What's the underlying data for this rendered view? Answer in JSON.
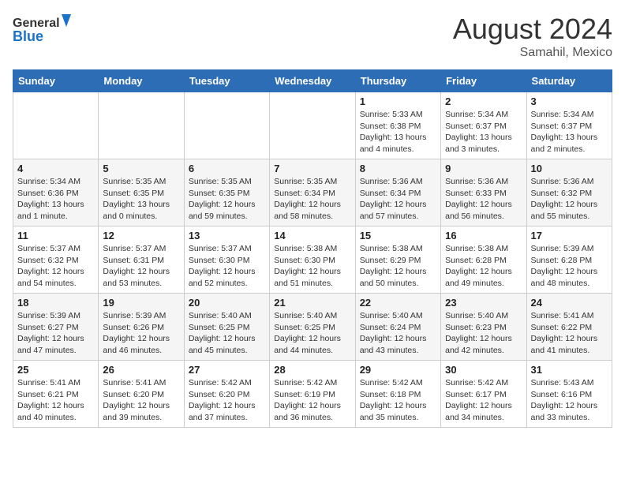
{
  "header": {
    "logo_general": "General",
    "logo_blue": "Blue",
    "month_year": "August 2024",
    "location": "Samahil, Mexico"
  },
  "days_of_week": [
    "Sunday",
    "Monday",
    "Tuesday",
    "Wednesday",
    "Thursday",
    "Friday",
    "Saturday"
  ],
  "weeks": [
    [
      {
        "day": "",
        "info": ""
      },
      {
        "day": "",
        "info": ""
      },
      {
        "day": "",
        "info": ""
      },
      {
        "day": "",
        "info": ""
      },
      {
        "day": "1",
        "info": "Sunrise: 5:33 AM\nSunset: 6:38 PM\nDaylight: 13 hours\nand 4 minutes."
      },
      {
        "day": "2",
        "info": "Sunrise: 5:34 AM\nSunset: 6:37 PM\nDaylight: 13 hours\nand 3 minutes."
      },
      {
        "day": "3",
        "info": "Sunrise: 5:34 AM\nSunset: 6:37 PM\nDaylight: 13 hours\nand 2 minutes."
      }
    ],
    [
      {
        "day": "4",
        "info": "Sunrise: 5:34 AM\nSunset: 6:36 PM\nDaylight: 13 hours\nand 1 minute."
      },
      {
        "day": "5",
        "info": "Sunrise: 5:35 AM\nSunset: 6:35 PM\nDaylight: 13 hours\nand 0 minutes."
      },
      {
        "day": "6",
        "info": "Sunrise: 5:35 AM\nSunset: 6:35 PM\nDaylight: 12 hours\nand 59 minutes."
      },
      {
        "day": "7",
        "info": "Sunrise: 5:35 AM\nSunset: 6:34 PM\nDaylight: 12 hours\nand 58 minutes."
      },
      {
        "day": "8",
        "info": "Sunrise: 5:36 AM\nSunset: 6:34 PM\nDaylight: 12 hours\nand 57 minutes."
      },
      {
        "day": "9",
        "info": "Sunrise: 5:36 AM\nSunset: 6:33 PM\nDaylight: 12 hours\nand 56 minutes."
      },
      {
        "day": "10",
        "info": "Sunrise: 5:36 AM\nSunset: 6:32 PM\nDaylight: 12 hours\nand 55 minutes."
      }
    ],
    [
      {
        "day": "11",
        "info": "Sunrise: 5:37 AM\nSunset: 6:32 PM\nDaylight: 12 hours\nand 54 minutes."
      },
      {
        "day": "12",
        "info": "Sunrise: 5:37 AM\nSunset: 6:31 PM\nDaylight: 12 hours\nand 53 minutes."
      },
      {
        "day": "13",
        "info": "Sunrise: 5:37 AM\nSunset: 6:30 PM\nDaylight: 12 hours\nand 52 minutes."
      },
      {
        "day": "14",
        "info": "Sunrise: 5:38 AM\nSunset: 6:30 PM\nDaylight: 12 hours\nand 51 minutes."
      },
      {
        "day": "15",
        "info": "Sunrise: 5:38 AM\nSunset: 6:29 PM\nDaylight: 12 hours\nand 50 minutes."
      },
      {
        "day": "16",
        "info": "Sunrise: 5:38 AM\nSunset: 6:28 PM\nDaylight: 12 hours\nand 49 minutes."
      },
      {
        "day": "17",
        "info": "Sunrise: 5:39 AM\nSunset: 6:28 PM\nDaylight: 12 hours\nand 48 minutes."
      }
    ],
    [
      {
        "day": "18",
        "info": "Sunrise: 5:39 AM\nSunset: 6:27 PM\nDaylight: 12 hours\nand 47 minutes."
      },
      {
        "day": "19",
        "info": "Sunrise: 5:39 AM\nSunset: 6:26 PM\nDaylight: 12 hours\nand 46 minutes."
      },
      {
        "day": "20",
        "info": "Sunrise: 5:40 AM\nSunset: 6:25 PM\nDaylight: 12 hours\nand 45 minutes."
      },
      {
        "day": "21",
        "info": "Sunrise: 5:40 AM\nSunset: 6:25 PM\nDaylight: 12 hours\nand 44 minutes."
      },
      {
        "day": "22",
        "info": "Sunrise: 5:40 AM\nSunset: 6:24 PM\nDaylight: 12 hours\nand 43 minutes."
      },
      {
        "day": "23",
        "info": "Sunrise: 5:40 AM\nSunset: 6:23 PM\nDaylight: 12 hours\nand 42 minutes."
      },
      {
        "day": "24",
        "info": "Sunrise: 5:41 AM\nSunset: 6:22 PM\nDaylight: 12 hours\nand 41 minutes."
      }
    ],
    [
      {
        "day": "25",
        "info": "Sunrise: 5:41 AM\nSunset: 6:21 PM\nDaylight: 12 hours\nand 40 minutes."
      },
      {
        "day": "26",
        "info": "Sunrise: 5:41 AM\nSunset: 6:20 PM\nDaylight: 12 hours\nand 39 minutes."
      },
      {
        "day": "27",
        "info": "Sunrise: 5:42 AM\nSunset: 6:20 PM\nDaylight: 12 hours\nand 37 minutes."
      },
      {
        "day": "28",
        "info": "Sunrise: 5:42 AM\nSunset: 6:19 PM\nDaylight: 12 hours\nand 36 minutes."
      },
      {
        "day": "29",
        "info": "Sunrise: 5:42 AM\nSunset: 6:18 PM\nDaylight: 12 hours\nand 35 minutes."
      },
      {
        "day": "30",
        "info": "Sunrise: 5:42 AM\nSunset: 6:17 PM\nDaylight: 12 hours\nand 34 minutes."
      },
      {
        "day": "31",
        "info": "Sunrise: 5:43 AM\nSunset: 6:16 PM\nDaylight: 12 hours\nand 33 minutes."
      }
    ]
  ]
}
